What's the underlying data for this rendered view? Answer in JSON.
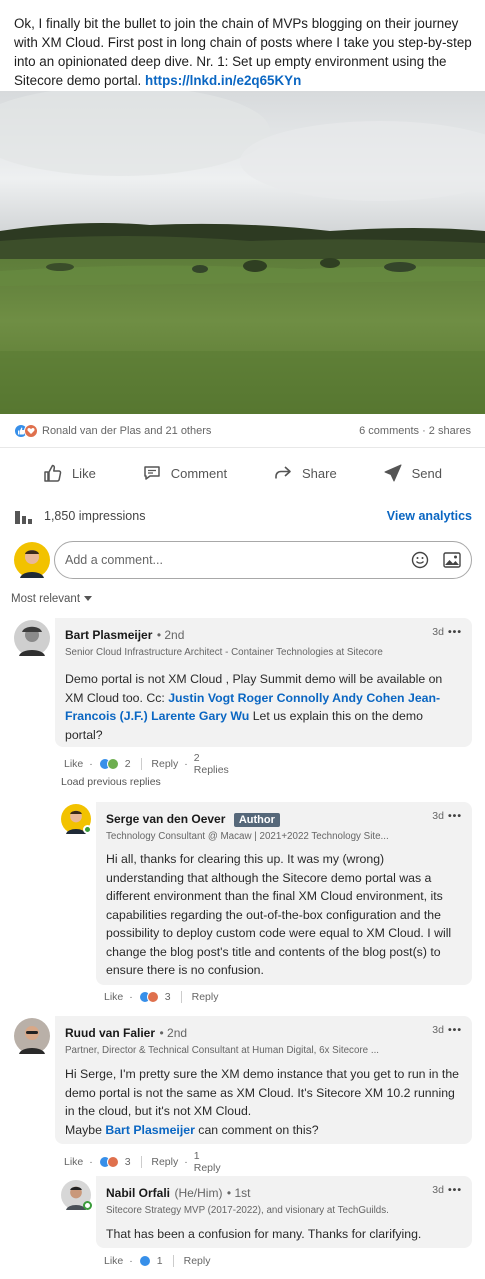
{
  "post": {
    "text": "Ok, I finally bit the bullet to join the chain of MVPs blogging on their journey with XM Cloud. First post in long chain of posts where I take you step-by-step into an opinionated deep dive. Nr. 1: Set up empty environment using the Sitecore demo portal.",
    "link": "https://lnkd.in/e2q65KYn"
  },
  "social": {
    "reactions_text": "Ronald van der Plas and 21 others",
    "comments_shares": "6 comments · 2 shares"
  },
  "actions": {
    "like": "Like",
    "comment": "Comment",
    "share": "Share",
    "send": "Send"
  },
  "analytics": {
    "impressions": "1,850 impressions",
    "view": "View analytics"
  },
  "compose": {
    "placeholder": "Add a comment..."
  },
  "sort": {
    "label": "Most relevant"
  },
  "comments": [
    {
      "name": "Bart Plasmeijer",
      "degree": "• 2nd",
      "headline": "Senior Cloud Infrastructure Architect - Container Technologies at Sitecore",
      "time": "3d",
      "body_pre": "Demo portal is not XM Cloud , Play Summit demo will be available on XM Cloud too. Cc: ",
      "mentions": "Justin Vogt Roger Connolly Andy Cohen Jean-Francois (J.F.) Larente Gary Wu",
      "body_post": " Let us explain this on the demo portal?",
      "like": "Like",
      "count": "2",
      "reply": "Reply",
      "replies": "2 Replies"
    },
    {
      "name": "Serge van den Oever",
      "badge": "Author",
      "headline": "Technology Consultant @ Macaw | 2021+2022 Technology Site...",
      "time": "3d",
      "body": "Hi all, thanks for clearing this up. It was my (wrong) understanding that although the Sitecore demo portal was a different environment than the final XM Cloud environment, its capabilities regarding the out-of-the-box configuration and the possibility to deploy custom code were equal to XM Cloud. I will change the blog post's title and contents of the blog post(s) to ensure there is no confusion.",
      "like": "Like",
      "count": "3",
      "reply": "Reply"
    },
    {
      "name": "Ruud van Falier",
      "degree": "• 2nd",
      "headline": "Partner, Director & Technical Consultant at Human Digital, 6x Sitecore ...",
      "time": "3d",
      "body": "Hi Serge, I'm pretty sure the XM demo instance that you get to run in the demo portal is not the same as XM Cloud. It's Sitecore XM 10.2 running in the cloud, but it's not XM Cloud.",
      "body2_pre": "Maybe ",
      "mention": "Bart Plasmeijer",
      "body2_post": " can comment on this?",
      "like": "Like",
      "count": "3",
      "reply": "Reply",
      "replies": "1 Reply"
    },
    {
      "name": "Nabil Orfali",
      "pronoun": "(He/Him)",
      "degree": "• 1st",
      "headline": "Sitecore Strategy MVP (2017-2022), and visionary at TechGuilds.",
      "time": "3d",
      "body": "That has been a confusion for many. Thanks for clarifying.",
      "like": "Like",
      "count": "1",
      "reply": "Reply"
    }
  ],
  "load_previous": "Load previous replies",
  "colors": {
    "link": "#0a66c2",
    "bubble": "#f2f2f2",
    "author_badge": "#56687a"
  }
}
